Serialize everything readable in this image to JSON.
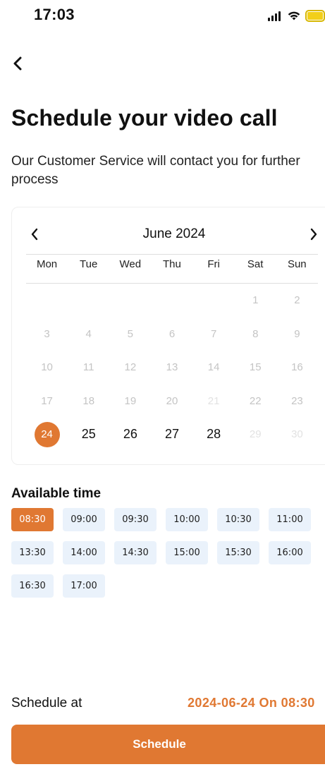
{
  "status_bar": {
    "time": "17:03",
    "icons": [
      "signal-icon",
      "wifi-icon",
      "battery-icon"
    ],
    "battery_color": "#f2cf1a"
  },
  "header": {
    "back_icon": "chevron-left-icon",
    "title": "Schedule your video call",
    "subtitle": "Our Customer Service will contact you for further process"
  },
  "calendar": {
    "month_label": "June 2024",
    "prev_icon": "chevron-left-icon",
    "next_icon": "chevron-right-icon",
    "weekdays": [
      "Mon",
      "Tue",
      "Wed",
      "Thu",
      "Fri",
      "Sat",
      "Sun"
    ],
    "weeks": [
      [
        {
          "label": "",
          "state": "empty"
        },
        {
          "label": "",
          "state": "empty"
        },
        {
          "label": "",
          "state": "empty"
        },
        {
          "label": "",
          "state": "empty"
        },
        {
          "label": "",
          "state": "empty"
        },
        {
          "label": "1",
          "state": "disabled"
        },
        {
          "label": "2",
          "state": "disabled"
        }
      ],
      [
        {
          "label": "3",
          "state": "disabled"
        },
        {
          "label": "4",
          "state": "disabled"
        },
        {
          "label": "5",
          "state": "disabled"
        },
        {
          "label": "6",
          "state": "disabled"
        },
        {
          "label": "7",
          "state": "disabled"
        },
        {
          "label": "8",
          "state": "disabled"
        },
        {
          "label": "9",
          "state": "disabled"
        }
      ],
      [
        {
          "label": "10",
          "state": "disabled"
        },
        {
          "label": "11",
          "state": "disabled"
        },
        {
          "label": "12",
          "state": "disabled"
        },
        {
          "label": "13",
          "state": "disabled"
        },
        {
          "label": "14",
          "state": "disabled"
        },
        {
          "label": "15",
          "state": "disabled"
        },
        {
          "label": "16",
          "state": "disabled"
        }
      ],
      [
        {
          "label": "17",
          "state": "disabled"
        },
        {
          "label": "18",
          "state": "disabled"
        },
        {
          "label": "19",
          "state": "disabled"
        },
        {
          "label": "20",
          "state": "disabled"
        },
        {
          "label": "21",
          "state": "faint"
        },
        {
          "label": "22",
          "state": "disabled"
        },
        {
          "label": "23",
          "state": "disabled"
        }
      ],
      [
        {
          "label": "24",
          "state": "selected"
        },
        {
          "label": "25",
          "state": "active"
        },
        {
          "label": "26",
          "state": "active"
        },
        {
          "label": "27",
          "state": "active"
        },
        {
          "label": "28",
          "state": "active"
        },
        {
          "label": "29",
          "state": "faint"
        },
        {
          "label": "30",
          "state": "faint"
        }
      ]
    ]
  },
  "available_time": {
    "title": "Available time",
    "slots": [
      {
        "time": "08:30",
        "selected": true
      },
      {
        "time": "09:00",
        "selected": false
      },
      {
        "time": "09:30",
        "selected": false
      },
      {
        "time": "10:00",
        "selected": false
      },
      {
        "time": "10:30",
        "selected": false
      },
      {
        "time": "11:00",
        "selected": false
      },
      {
        "time": "13:30",
        "selected": false
      },
      {
        "time": "14:00",
        "selected": false
      },
      {
        "time": "14:30",
        "selected": false
      },
      {
        "time": "15:00",
        "selected": false
      },
      {
        "time": "15:30",
        "selected": false
      },
      {
        "time": "16:00",
        "selected": false
      },
      {
        "time": "16:30",
        "selected": false
      },
      {
        "time": "17:00",
        "selected": false
      }
    ]
  },
  "summary": {
    "label": "Schedule at",
    "value": "2024-06-24 On 08:30"
  },
  "footer": {
    "button_label": "Schedule"
  },
  "colors": {
    "accent": "#e07832",
    "slot_background": "#eaf2fb",
    "disabled_text": "#c4c4c4"
  }
}
